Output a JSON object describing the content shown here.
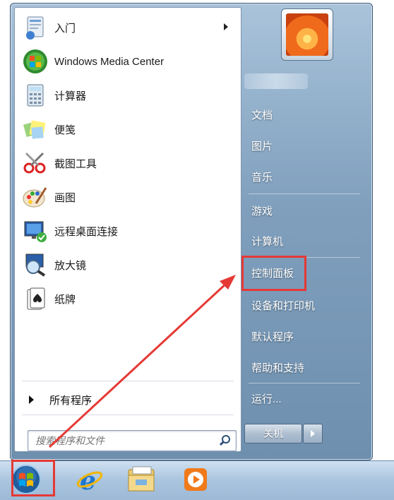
{
  "start_menu": {
    "programs": [
      {
        "label": "入门",
        "icon": "getting-started-icon",
        "has_submenu": true
      },
      {
        "label": "Windows Media Center",
        "icon": "windows-media-center-icon"
      },
      {
        "label": "计算器",
        "icon": "calculator-icon"
      },
      {
        "label": "便笺",
        "icon": "sticky-notes-icon"
      },
      {
        "label": "截图工具",
        "icon": "snipping-tool-icon"
      },
      {
        "label": "画图",
        "icon": "paint-icon"
      },
      {
        "label": "远程桌面连接",
        "icon": "remote-desktop-icon"
      },
      {
        "label": "放大镜",
        "icon": "magnifier-icon"
      },
      {
        "label": "纸牌",
        "icon": "solitaire-icon"
      }
    ],
    "all_programs": "所有程序",
    "search": {
      "placeholder": "搜索程序和文件",
      "icon": "search-icon"
    },
    "right_items": [
      {
        "label": "文档"
      },
      {
        "label": "图片"
      },
      {
        "label": "音乐"
      },
      {
        "label": "游戏"
      },
      {
        "label": "计算机"
      },
      {
        "label": "控制面板"
      },
      {
        "label": "设备和打印机"
      },
      {
        "label": "默认程序"
      },
      {
        "label": "帮助和支持"
      },
      {
        "label": "运行..."
      }
    ],
    "shutdown_label": "关机"
  },
  "taskbar": {
    "items": [
      "start-orb-icon",
      "internet-explorer-icon",
      "windows-explorer-icon",
      "media-player-icon"
    ]
  },
  "colors": {
    "highlight": "#e53935",
    "accent": "#6e8fae"
  }
}
